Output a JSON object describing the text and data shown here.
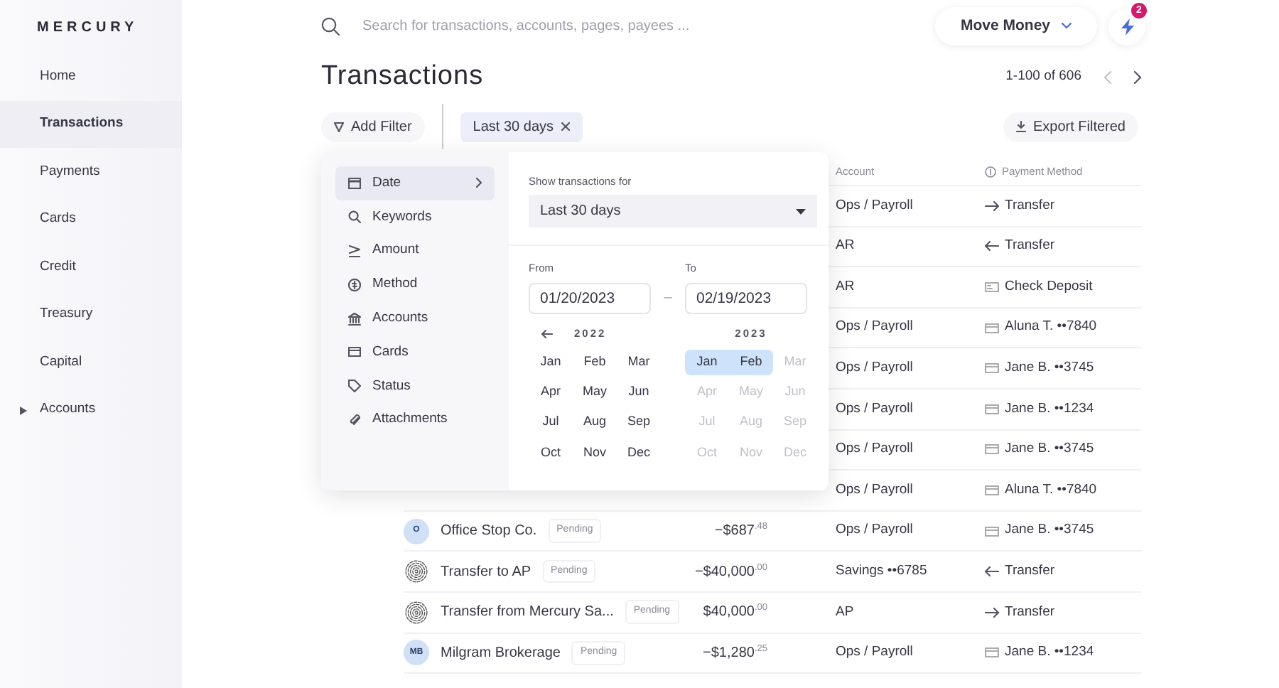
{
  "sidebar": {
    "logo": "MERCURY",
    "items": [
      {
        "label": "Home",
        "selected": false
      },
      {
        "label": "Transactions",
        "selected": true
      },
      {
        "label": "Payments",
        "selected": false
      },
      {
        "label": "Cards",
        "selected": false
      },
      {
        "label": "Credit",
        "selected": false
      },
      {
        "label": "Treasury",
        "selected": false
      },
      {
        "label": "Capital",
        "selected": false
      },
      {
        "label": "Accounts",
        "selected": false,
        "expandable": true
      }
    ]
  },
  "search": {
    "placeholder": "Search for transactions, accounts, pages, payees ..."
  },
  "header_actions": {
    "move_money": "Move Money",
    "notification_count": "2"
  },
  "title": "Transactions",
  "pagination": {
    "range": "1-100 of 606"
  },
  "filters": {
    "add_filter": "Add Filter",
    "chips": [
      "Last 30 days"
    ],
    "export": "Export Filtered"
  },
  "table": {
    "columns": [
      "Account",
      "Payment Method"
    ],
    "rows": [
      {
        "account": "Ops / Payroll",
        "method": {
          "kind": "transfer_out",
          "text": "Transfer"
        }
      },
      {
        "account": "AR",
        "method": {
          "kind": "transfer_in",
          "text": "Transfer"
        }
      },
      {
        "account": "AR",
        "method": {
          "kind": "check",
          "text": "Check Deposit"
        }
      },
      {
        "account": "Ops / Payroll",
        "method": {
          "kind": "card",
          "text": "Aluna T. ••7840"
        }
      },
      {
        "account": "Ops / Payroll",
        "method": {
          "kind": "card",
          "text": "Jane B. ••3745"
        }
      },
      {
        "account": "Ops / Payroll",
        "method": {
          "kind": "card",
          "text": "Jane B. ••1234"
        }
      },
      {
        "account": "Ops / Payroll",
        "method": {
          "kind": "card",
          "text": "Jane B. ••3745"
        }
      },
      {
        "account": "Ops / Payroll",
        "method": {
          "kind": "card",
          "text": "Aluna T. ••7840"
        }
      },
      {
        "avatar": {
          "kind": "initials",
          "text": "O"
        },
        "name": "Office Stop Co.",
        "status": "Pending",
        "amount": "−$687$^{.48}$",
        "account": "Ops / Payroll",
        "method": {
          "kind": "card",
          "text": "Jane B. ••3745"
        }
      },
      {
        "avatar": {
          "kind": "logo"
        },
        "name": "Transfer to AP",
        "status": "Pending",
        "amount": "−$40,000$^{.00}$",
        "account": "Savings ••6785",
        "method": {
          "kind": "transfer_in",
          "text": "Transfer"
        }
      },
      {
        "avatar": {
          "kind": "logo"
        },
        "name": "Transfer from Mercury Sa...",
        "status": "Pending",
        "amount": "$40,000$^{.00}$",
        "account": "AP",
        "method": {
          "kind": "transfer_out",
          "text": "Transfer"
        }
      },
      {
        "avatar": {
          "kind": "initials",
          "text": "MB"
        },
        "name": "Milgram Brokerage",
        "status": "Pending",
        "amount": "−$1,280$^{.25}$",
        "account": "Ops / Payroll",
        "method": {
          "kind": "card",
          "text": "Jane B. ••1234"
        }
      }
    ]
  },
  "filter_menu": {
    "items": [
      {
        "label": "Date",
        "selected": true
      },
      {
        "label": "Keywords",
        "selected": false
      },
      {
        "label": "Amount",
        "selected": false
      },
      {
        "label": "Method",
        "selected": false
      },
      {
        "label": "Accounts",
        "selected": false
      },
      {
        "label": "Cards",
        "selected": false
      },
      {
        "label": "Status",
        "selected": false
      },
      {
        "label": "Attachments",
        "selected": false
      }
    ],
    "date": {
      "show_label": "Show transactions for",
      "preset": "Last 30 days",
      "from_label": "From",
      "from": "01/20/2023",
      "separator": "–",
      "to_label": "To",
      "to": "02/19/2023",
      "years": [
        {
          "label": "2022",
          "months": [
            {
              "label": "Jan",
              "selected": false,
              "disabled": false
            },
            {
              "label": "Feb",
              "selected": false,
              "disabled": false
            },
            {
              "label": "Mar",
              "selected": false,
              "disabled": false
            },
            {
              "label": "Apr",
              "selected": false,
              "disabled": false
            },
            {
              "label": "May",
              "selected": false,
              "disabled": false
            },
            {
              "label": "Jun",
              "selected": false,
              "disabled": false
            },
            {
              "label": "Jul",
              "selected": false,
              "disabled": false
            },
            {
              "label": "Aug",
              "selected": false,
              "disabled": false
            },
            {
              "label": "Sep",
              "selected": false,
              "disabled": false
            },
            {
              "label": "Oct",
              "selected": false,
              "disabled": false
            },
            {
              "label": "Nov",
              "selected": false,
              "disabled": false
            },
            {
              "label": "Dec",
              "selected": false,
              "disabled": false
            }
          ]
        },
        {
          "label": "2023",
          "months": [
            {
              "label": "Jan",
              "selected": true,
              "disabled": false
            },
            {
              "label": "Feb",
              "selected": true,
              "disabled": false
            },
            {
              "label": "Mar",
              "selected": false,
              "disabled": true
            },
            {
              "label": "Apr",
              "selected": false,
              "disabled": true
            },
            {
              "label": "May",
              "selected": false,
              "disabled": true
            },
            {
              "label": "Jun",
              "selected": false,
              "disabled": true
            },
            {
              "label": "Jul",
              "selected": false,
              "disabled": true
            },
            {
              "label": "Aug",
              "selected": false,
              "disabled": true
            },
            {
              "label": "Sep",
              "selected": false,
              "disabled": true
            },
            {
              "label": "Oct",
              "selected": false,
              "disabled": true
            },
            {
              "label": "Nov",
              "selected": false,
              "disabled": true
            },
            {
              "label": "Dec",
              "selected": false,
              "disabled": true
            }
          ]
        }
      ]
    }
  }
}
